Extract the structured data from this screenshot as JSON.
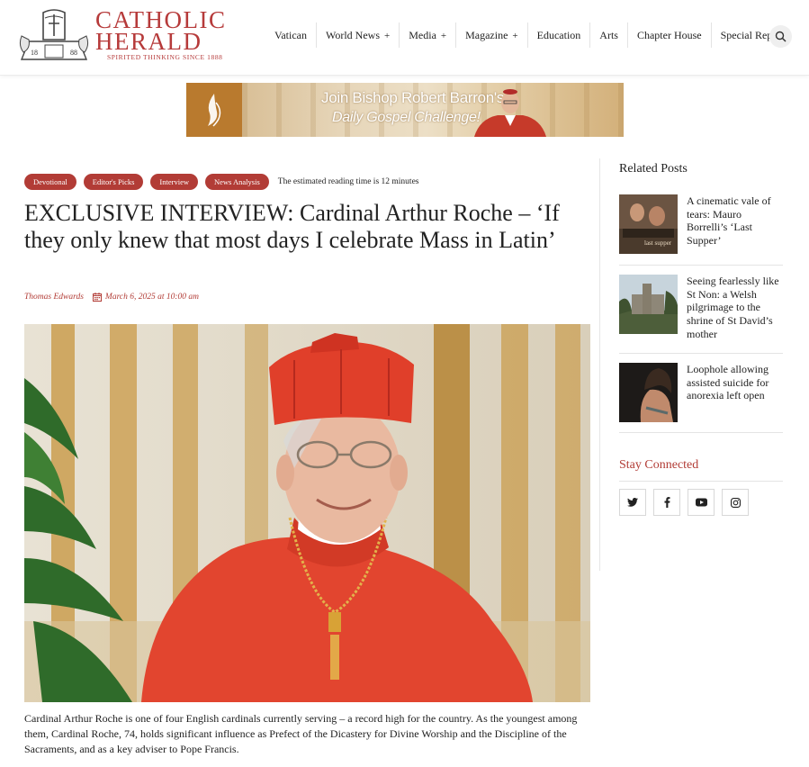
{
  "site": {
    "title_line1": "CATHOLIC",
    "title_line2": "HERALD",
    "tagline": "SPIRITED THINKING SINCE 1888",
    "emblem_left_num": "18",
    "emblem_right_num": "88"
  },
  "nav": {
    "items": [
      {
        "label": "Vatican",
        "plus": ""
      },
      {
        "label": "World News",
        "plus": "+"
      },
      {
        "label": "Media",
        "plus": "+"
      },
      {
        "label": "Magazine",
        "plus": "+"
      },
      {
        "label": "Education",
        "plus": ""
      },
      {
        "label": "Arts",
        "plus": ""
      },
      {
        "label": "Chapter House",
        "plus": ""
      },
      {
        "label": "Special Reports",
        "plus": ""
      }
    ],
    "search_icon": "search-icon"
  },
  "ad": {
    "line1": "Join Bishop Robert Barron's",
    "line2": "Daily Gospel Challenge!"
  },
  "article": {
    "tags": [
      "Devotional",
      "Editor's Picks",
      "Interview",
      "News Analysis"
    ],
    "reading_time": "The estimated reading time is 12 minutes",
    "title": "EXCLUSIVE INTERVIEW: Cardinal Arthur Roche – ‘If they only knew that most days I celebrate Mass in Latin’",
    "author": "Thomas Edwards",
    "date": "March 6, 2025 at 10:00 am",
    "caption": "Cardinal Arthur Roche is one of four English cardinals currently serving – a record high for the country. As the youngest among them, Cardinal Roche, 74, holds significant influence as Prefect of the Dicastery for Divine Worship and the Discipline of the Sacraments, and as a key adviser to Pope Francis."
  },
  "sidebar": {
    "heading": "Related Posts",
    "posts": [
      {
        "title": "A cinematic vale of tears: Mauro Borrelli’s ‘Last Supper’",
        "thumb_text": "last supper"
      },
      {
        "title": "Seeing fearlessly like St Non: a Welsh pilgrimage to the shrine of St David’s mother"
      },
      {
        "title": "Loophole allowing assisted suicide for anorexia left open"
      }
    ],
    "stay_heading": "Stay Connected",
    "socials": [
      "twitter-icon",
      "facebook-icon",
      "youtube-icon",
      "instagram-icon"
    ]
  },
  "colors": {
    "brand_red": "#b23c36",
    "text": "#222222"
  }
}
